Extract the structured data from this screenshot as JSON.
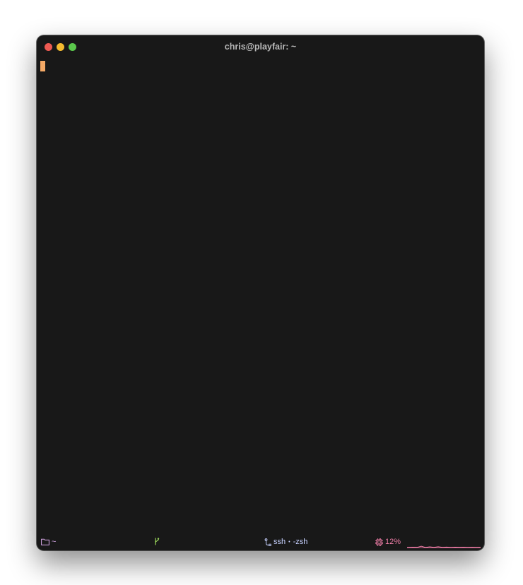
{
  "window": {
    "title": "chris@playfair: ~"
  },
  "statusbar": {
    "cwd": "~",
    "git_branch": "",
    "process": "ssh",
    "separator": "•",
    "shell": "-zsh",
    "cpu": "12%"
  },
  "icons": {
    "cwd": "folder-icon",
    "git": "git-branch-icon",
    "process": "process-icon",
    "cpu": "cpu-icon"
  },
  "colors": {
    "background": "#181818",
    "cursor": "#f4a966",
    "close": "#ee5a52",
    "minimize": "#f5bb2f",
    "zoom": "#5bc84c",
    "cwd": "#d7a8e8",
    "git": "#9bd65b",
    "process": "#c7d1ff",
    "cpu": "#f07ea8"
  }
}
